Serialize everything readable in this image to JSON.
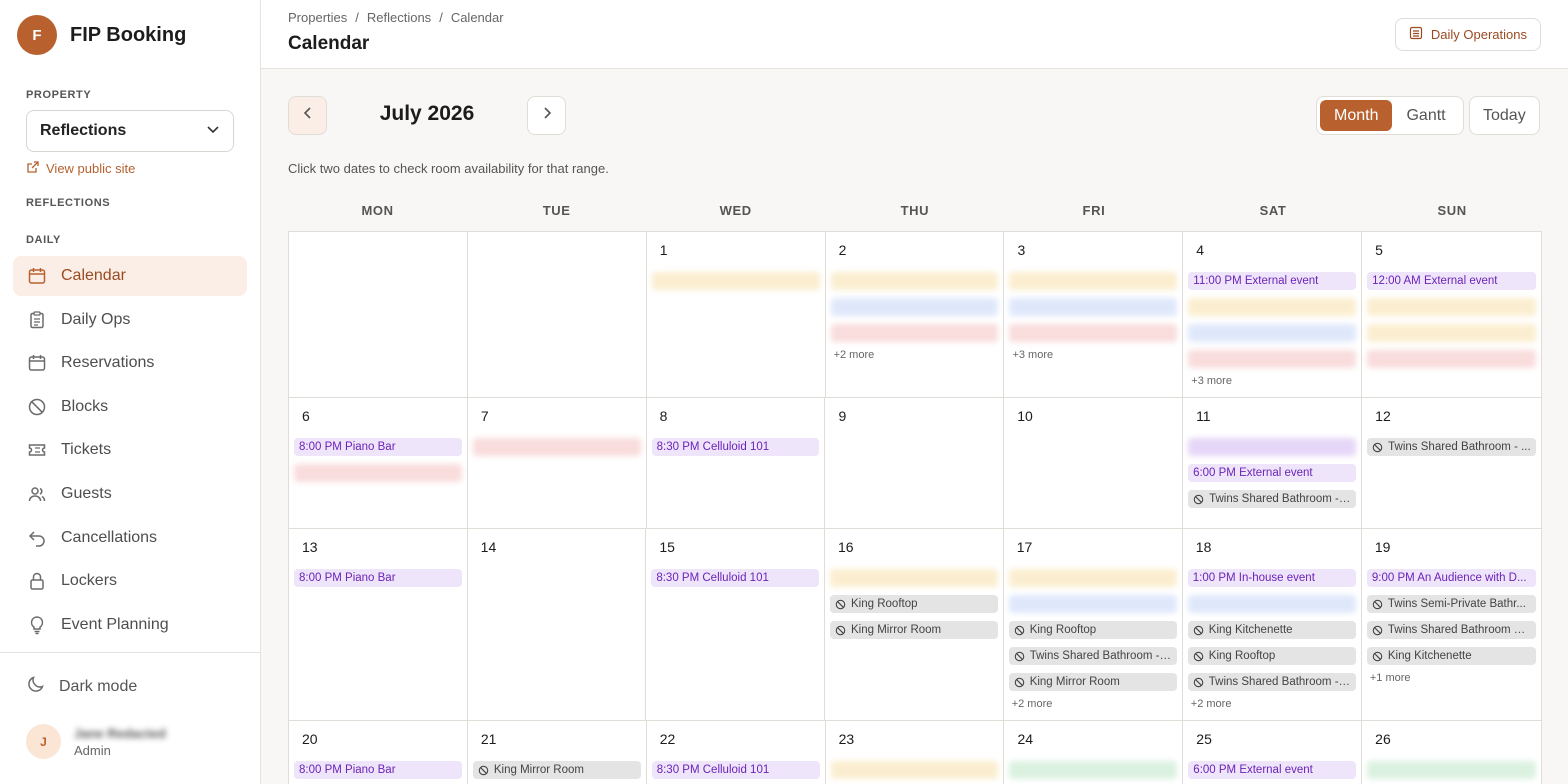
{
  "app": {
    "name": "FIP Booking",
    "logo_letter": "F"
  },
  "sidebar": {
    "property_label": "PROPERTY",
    "property_value": "Reflections",
    "view_public": "View public site",
    "section_label": "REFLECTIONS",
    "group_label": "DAILY",
    "items": [
      {
        "label": "Calendar",
        "icon": "calendar-icon",
        "active": true
      },
      {
        "label": "Daily Ops",
        "icon": "clipboard-icon"
      },
      {
        "label": "Reservations",
        "icon": "calendar-icon"
      },
      {
        "label": "Blocks",
        "icon": "ban-icon"
      },
      {
        "label": "Tickets",
        "icon": "ticket-icon"
      },
      {
        "label": "Guests",
        "icon": "users-icon"
      },
      {
        "label": "Cancellations",
        "icon": "undo-icon"
      },
      {
        "label": "Lockers",
        "icon": "lock-icon"
      },
      {
        "label": "Event Planning",
        "icon": "lightbulb-icon"
      }
    ],
    "dark_mode": "Dark mode",
    "user": {
      "initial": "J",
      "name": "Jane Redacted",
      "role": "Admin"
    }
  },
  "header": {
    "breadcrumb": [
      "Properties",
      "Reflections",
      "Calendar"
    ],
    "title": "Calendar",
    "daily_ops_button": "Daily Operations"
  },
  "calendar": {
    "month_label": "July 2026",
    "views": [
      "Month",
      "Gantt"
    ],
    "active_view": "Month",
    "today_label": "Today",
    "hint": "Click two dates to check room availability for that range.",
    "weekdays": [
      "MON",
      "TUE",
      "WED",
      "THU",
      "FRI",
      "SAT",
      "SUN"
    ],
    "weeks": [
      [
        {
          "day": "",
          "events": []
        },
        {
          "day": "",
          "events": []
        },
        {
          "day": "1",
          "events": [
            {
              "type": "blur",
              "color": "yellow"
            }
          ]
        },
        {
          "day": "2",
          "events": [
            {
              "type": "blur",
              "color": "yellow"
            },
            {
              "type": "blur",
              "color": "blue"
            },
            {
              "type": "blur",
              "color": "red"
            }
          ],
          "more": "+2 more"
        },
        {
          "day": "3",
          "events": [
            {
              "type": "blur",
              "color": "yellow"
            },
            {
              "type": "blur",
              "color": "blue"
            },
            {
              "type": "blur",
              "color": "red"
            }
          ],
          "more": "+3 more"
        },
        {
          "day": "4",
          "events": [
            {
              "type": "purple",
              "text": "11:00 PM External event"
            },
            {
              "type": "blur",
              "color": "yellow"
            },
            {
              "type": "blur",
              "color": "blue"
            },
            {
              "type": "blur",
              "color": "red"
            }
          ],
          "more": "+3 more"
        },
        {
          "day": "5",
          "events": [
            {
              "type": "purple",
              "text": "12:00 AM External event"
            },
            {
              "type": "blur",
              "color": "yellow"
            },
            {
              "type": "blur",
              "color": "yellow"
            },
            {
              "type": "blur",
              "color": "red"
            }
          ]
        }
      ],
      [
        {
          "day": "6",
          "events": [
            {
              "type": "purple",
              "text": "8:00 PM Piano Bar"
            },
            {
              "type": "blur",
              "color": "red"
            }
          ]
        },
        {
          "day": "7",
          "events": [
            {
              "type": "blur",
              "color": "red"
            }
          ]
        },
        {
          "day": "8",
          "events": [
            {
              "type": "purple",
              "text": "8:30 PM Celluloid 101"
            }
          ]
        },
        {
          "day": "9",
          "events": []
        },
        {
          "day": "10",
          "events": []
        },
        {
          "day": "11",
          "events": [
            {
              "type": "blur",
              "color": "purplebl"
            },
            {
              "type": "purple",
              "text": "6:00 PM External event"
            },
            {
              "type": "gray",
              "text": "Twins Shared Bathroom - ..."
            }
          ]
        },
        {
          "day": "12",
          "events": [
            {
              "type": "gray",
              "text": "Twins Shared Bathroom - ..."
            }
          ]
        }
      ],
      [
        {
          "day": "13",
          "events": [
            {
              "type": "purple",
              "text": "8:00 PM Piano Bar"
            }
          ]
        },
        {
          "day": "14",
          "events": []
        },
        {
          "day": "15",
          "events": [
            {
              "type": "purple",
              "text": "8:30 PM Celluloid 101"
            }
          ]
        },
        {
          "day": "16",
          "events": [
            {
              "type": "blur",
              "color": "yellow"
            },
            {
              "type": "gray",
              "text": "King Rooftop"
            },
            {
              "type": "gray",
              "text": "King Mirror Room"
            }
          ]
        },
        {
          "day": "17",
          "events": [
            {
              "type": "blur",
              "color": "yellow"
            },
            {
              "type": "blur",
              "color": "blue"
            },
            {
              "type": "gray",
              "text": "King Rooftop"
            },
            {
              "type": "gray",
              "text": "Twins Shared Bathroom - ..."
            },
            {
              "type": "gray",
              "text": "King Mirror Room"
            }
          ],
          "more": "+2 more"
        },
        {
          "day": "18",
          "events": [
            {
              "type": "purple",
              "text": "1:00 PM In-house event"
            },
            {
              "type": "blur",
              "color": "blue"
            },
            {
              "type": "gray",
              "text": "King Kitchenette"
            },
            {
              "type": "gray",
              "text": "King Rooftop"
            },
            {
              "type": "gray",
              "text": "Twins Shared Bathroom - ..."
            }
          ],
          "more": "+2 more"
        },
        {
          "day": "19",
          "events": [
            {
              "type": "purple",
              "text": "9:00 PM An Audience with D..."
            },
            {
              "type": "gray",
              "text": "Twins Semi-Private Bathr..."
            },
            {
              "type": "gray",
              "text": "Twins Shared Bathroom C..."
            },
            {
              "type": "gray",
              "text": "King Kitchenette"
            }
          ],
          "more": "+1 more"
        }
      ],
      [
        {
          "day": "20",
          "events": [
            {
              "type": "purple",
              "text": "8:00 PM Piano Bar"
            }
          ]
        },
        {
          "day": "21",
          "events": [
            {
              "type": "gray",
              "text": "King Mirror Room"
            }
          ]
        },
        {
          "day": "22",
          "events": [
            {
              "type": "purple",
              "text": "8:30 PM Celluloid 101"
            }
          ]
        },
        {
          "day": "23",
          "events": [
            {
              "type": "blur",
              "color": "yellow"
            }
          ]
        },
        {
          "day": "24",
          "events": [
            {
              "type": "blur",
              "color": "green"
            }
          ]
        },
        {
          "day": "25",
          "events": [
            {
              "type": "purple",
              "text": "6:00 PM External event"
            }
          ]
        },
        {
          "day": "26",
          "events": [
            {
              "type": "blur",
              "color": "green"
            }
          ]
        }
      ]
    ]
  }
}
